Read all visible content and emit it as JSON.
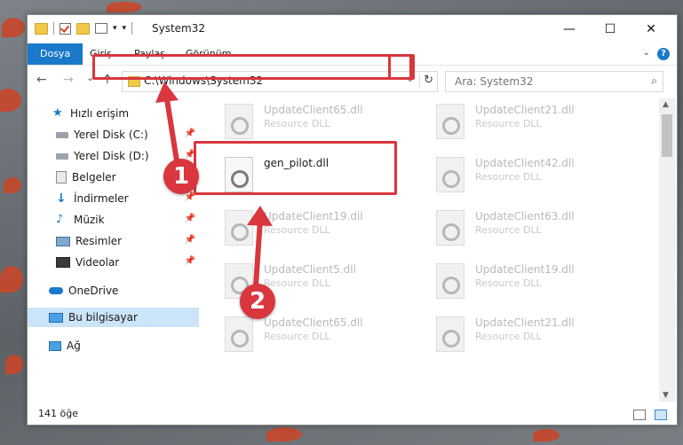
{
  "window": {
    "title": "System32",
    "controls": {
      "minimize": "—",
      "maximize": "☐",
      "close": "✕"
    }
  },
  "ribbon": {
    "tabs": [
      "Dosya",
      "Giriş",
      "Paylaş",
      "Görünüm"
    ],
    "active": "Dosya",
    "help": "?"
  },
  "nav": {
    "back": "←",
    "forward": "→",
    "recent": "⌄",
    "up": "↑",
    "address": "C:\\Windows\\System32",
    "search_placeholder": "Ara: System32"
  },
  "sidebar": {
    "items": [
      {
        "label": "Hızlı erişim",
        "icon": "star-icon",
        "pinned": false
      },
      {
        "label": "Yerel Disk (C:)",
        "icon": "drive-icon",
        "pinned": true
      },
      {
        "label": "Yerel Disk (D:)",
        "icon": "drive-icon",
        "pinned": true
      },
      {
        "label": "Belgeler",
        "icon": "documents-icon",
        "pinned": true
      },
      {
        "label": "İndirmeler",
        "icon": "download-icon",
        "pinned": true
      },
      {
        "label": "Müzik",
        "icon": "music-icon",
        "pinned": true
      },
      {
        "label": "Resimler",
        "icon": "pictures-icon",
        "pinned": true
      },
      {
        "label": "Videolar",
        "icon": "video-icon",
        "pinned": true
      },
      {
        "label": "OneDrive",
        "icon": "cloud-icon",
        "pinned": false
      },
      {
        "label": "Bu bilgisayar",
        "icon": "computer-icon",
        "pinned": false
      },
      {
        "label": "Ağ",
        "icon": "network-icon",
        "pinned": false
      }
    ],
    "selected": "Bu bilgisayar"
  },
  "files": [
    {
      "name": "UpdateClient65.dll",
      "type": "Resource DLL"
    },
    {
      "name": "UpdateClient21.dll",
      "type": "Resource DLL"
    },
    {
      "name": "gen_pilot.dll",
      "type": ""
    },
    {
      "name": "UpdateClient42.dll",
      "type": "Resource DLL"
    },
    {
      "name": "UpdateClient19.dll",
      "type": "Resource DLL"
    },
    {
      "name": "UpdateClient63.dll",
      "type": "Resource DLL"
    },
    {
      "name": "UpdateClient5.dll",
      "type": "Resource DLL"
    },
    {
      "name": "UpdateClient19.dll",
      "type": "Resource DLL"
    },
    {
      "name": "UpdateClient65.dll",
      "type": "Resource DLL"
    },
    {
      "name": "UpdateClient21.dll",
      "type": "Resource DLL"
    }
  ],
  "status": {
    "count": "141 öğe"
  },
  "annotations": {
    "step1": "1",
    "step2": "2",
    "color": "#d9363e"
  }
}
